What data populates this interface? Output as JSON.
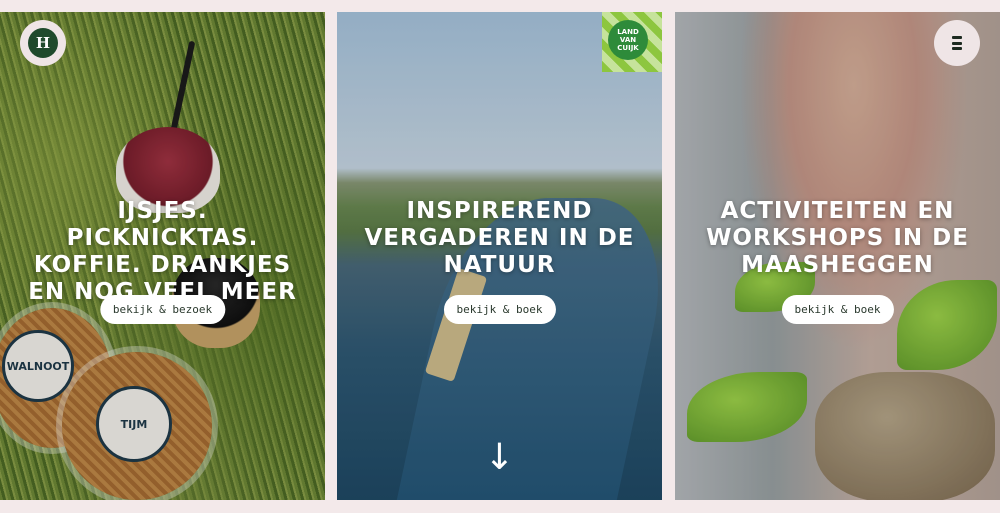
{
  "header": {
    "logo_letter": "H",
    "logo_icon": "house-logo-icon",
    "menu_icon": "menu-icon"
  },
  "panels": [
    {
      "headline": "IJSJES. PICKNICKTAS. KOFFIE. DRANKJES EN NOG VEEL MEER",
      "cta_label": "bekijk & bezoek",
      "decor_labels": [
        "WALNOOT",
        "TIJM"
      ]
    },
    {
      "headline": "INSPIREREND VERGADEREN IN DE NATUUR",
      "cta_label": "bekijk & boek",
      "badge_text": "LAND VAN CUIJK",
      "scroll_icon": "arrow-down-icon"
    },
    {
      "headline": "ACTIVITEITEN EN WORKSHOPS IN DE MAASHEGGEN",
      "cta_label": "bekijk & boek"
    }
  ],
  "colors": {
    "page_background": "#f3e9ea",
    "button_background": "#ffffff",
    "logo_green": "#1f4a2c",
    "badge_green": "#2e8b3a"
  }
}
